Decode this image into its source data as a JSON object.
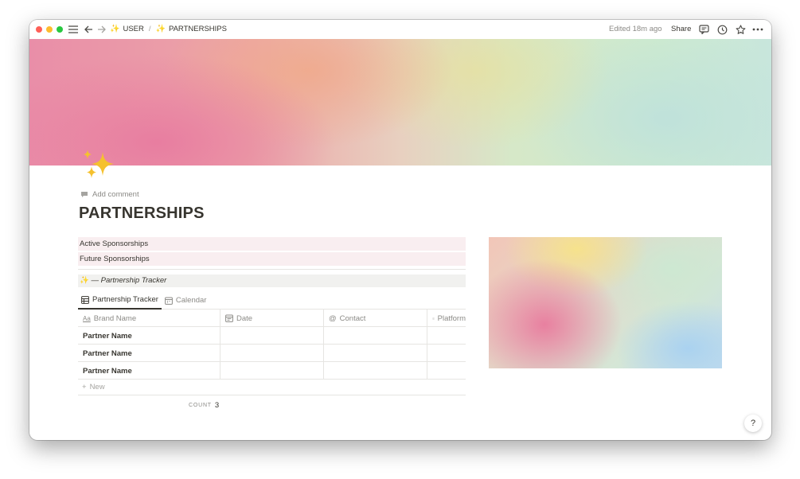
{
  "topbar": {
    "crumbs": [
      {
        "icon": "✨",
        "label": "USER"
      },
      {
        "icon": "✨",
        "label": "PARTNERSHIPS"
      }
    ],
    "separator": "/",
    "edited": "Edited 18m ago",
    "share_label": "Share"
  },
  "page": {
    "icon": "sparkles-emoji",
    "add_comment": "Add comment",
    "title": "PARTNERSHIPS",
    "links": [
      "Active Sponsorships",
      "Future Sponsorships"
    ],
    "callout": {
      "icon": "✨",
      "text": "— Partnership Tracker"
    }
  },
  "database": {
    "tabs": [
      {
        "label": "Partnership Tracker",
        "icon": "table-icon",
        "active": true
      },
      {
        "label": "Calendar",
        "icon": "calendar-icon",
        "active": false
      }
    ],
    "columns": [
      {
        "label": "Brand Name",
        "icon": "text-aa-icon"
      },
      {
        "label": "Date",
        "icon": "date-icon"
      },
      {
        "label": "Contact",
        "icon": "at-icon"
      },
      {
        "label": "Platform",
        "icon": "list-icon"
      }
    ],
    "rows": [
      [
        "Partner Name",
        "",
        "",
        ""
      ],
      [
        "Partner Name",
        "",
        "",
        ""
      ],
      [
        "Partner Name",
        "",
        "",
        ""
      ]
    ],
    "new_label": "New",
    "count_label": "COUNT",
    "count_value": "3"
  },
  "help_label": "?",
  "colors": {
    "text": "#37352f",
    "muted": "#8b8a86",
    "link_bg": "#f9eef0",
    "callout_bg": "#f1f1ef"
  }
}
